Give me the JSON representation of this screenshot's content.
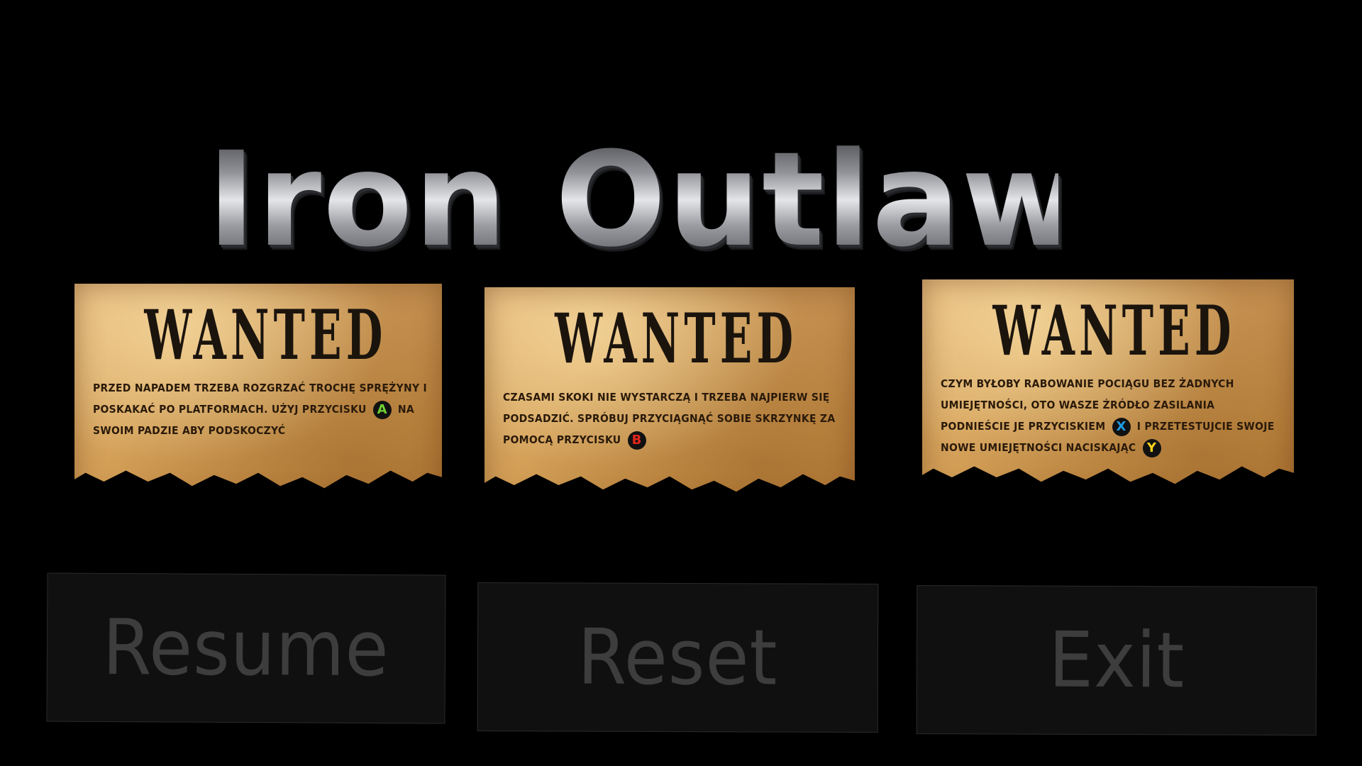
{
  "game": {
    "title": "Iron Outlaws"
  },
  "posters": [
    {
      "heading": "WANTED",
      "text_before": "PRZED NAPADEM TRZEBA ROZGRZAĆ TROCHĘ SPRĘŻYNY I POSKAKAĆ PO PLATFORMACH. UŻYJ PRZYCISKU",
      "button": "A",
      "text_after": "NA SWOIM PADZIE ABY PODSKOCZYĆ"
    },
    {
      "heading": "WANTED",
      "text_before": "CZASAMI SKOKI NIE WYSTARCZĄ I TRZEBA NAJPIERW SIĘ PODSADZIĆ. SPRÓBUJ PRZYCIĄGNĄĆ SOBIE SKRZYNKĘ ZA POMOCĄ PRZYCISKU",
      "button": "B"
    },
    {
      "heading": "WANTED",
      "text_before": "CZYM BYŁOBY RABOWANIE POCIĄGU BEZ ŻADNYCH UMIEJĘTNOŚCI, OTO WASZE ŹRÓDŁO ZASILANIA PODNIEŚCIE JE PRZYCISKIEM",
      "button_1": "X",
      "text_middle": "I PRZETESTUJCIE SWOJE NOWE UMIEJĘTNOŚCI NACISKAJĄC",
      "button_2": "Y"
    }
  ],
  "menu": {
    "resume": "Resume",
    "reset": "Reset",
    "exit": "Exit"
  },
  "colors": {
    "background": "#000000",
    "button_a": "#6fd036",
    "button_b": "#e3261c",
    "button_x": "#1f9ce3",
    "button_y": "#f4d21c",
    "menu_text": "#3d3d3d"
  },
  "icons": [
    "gamepad-a-button-icon",
    "gamepad-b-button-icon",
    "gamepad-x-button-icon",
    "gamepad-y-button-icon"
  ]
}
